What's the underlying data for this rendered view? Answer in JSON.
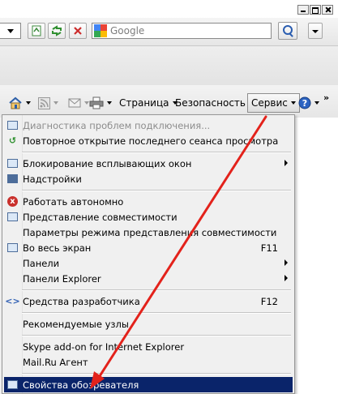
{
  "search": {
    "placeholder": "Google"
  },
  "command_bar": {
    "page": "Страница",
    "safety": "Безопасность",
    "tools": "Сервис",
    "chevrons": "»"
  },
  "menu": {
    "items": [
      {
        "label": "Диагностика проблем подключения...",
        "disabled": true,
        "icon": "network-diagnose-icon"
      },
      {
        "label": "Повторное открытие последнего сеанса просмотра",
        "icon": "reopen-session-icon"
      },
      {
        "label": "Блокирование всплывающих окон",
        "submenu": true,
        "icon": "popup-blocker-icon"
      },
      {
        "label": "Надстройки",
        "icon": "addons-icon"
      },
      {
        "label": "Работать автономно",
        "icon": "offline-icon"
      },
      {
        "label": "Представление совместимости",
        "icon": "compatibility-view-icon"
      },
      {
        "label": "Параметры режима представления совместимости"
      },
      {
        "label": "Во весь экран",
        "shortcut": "F11",
        "icon": "fullscreen-icon"
      },
      {
        "label": "Панели",
        "submenu": true
      },
      {
        "label": "Панели Explorer",
        "submenu": true
      },
      {
        "label": "Средства разработчика",
        "shortcut": "F12",
        "icon": "developer-tools-icon"
      },
      {
        "label": "Рекомендуемые узлы"
      },
      {
        "label": "Skype add-on for Internet Explorer"
      },
      {
        "label": "Mail.Ru Агент"
      },
      {
        "label": "Свойства обозревателя",
        "selected": true,
        "icon": "internet-options-icon"
      }
    ]
  },
  "annotation": {
    "arrow_color": "#e3221b"
  },
  "colors": {
    "selection": "#0a246a",
    "menu_bg": "#f0f0f0"
  }
}
